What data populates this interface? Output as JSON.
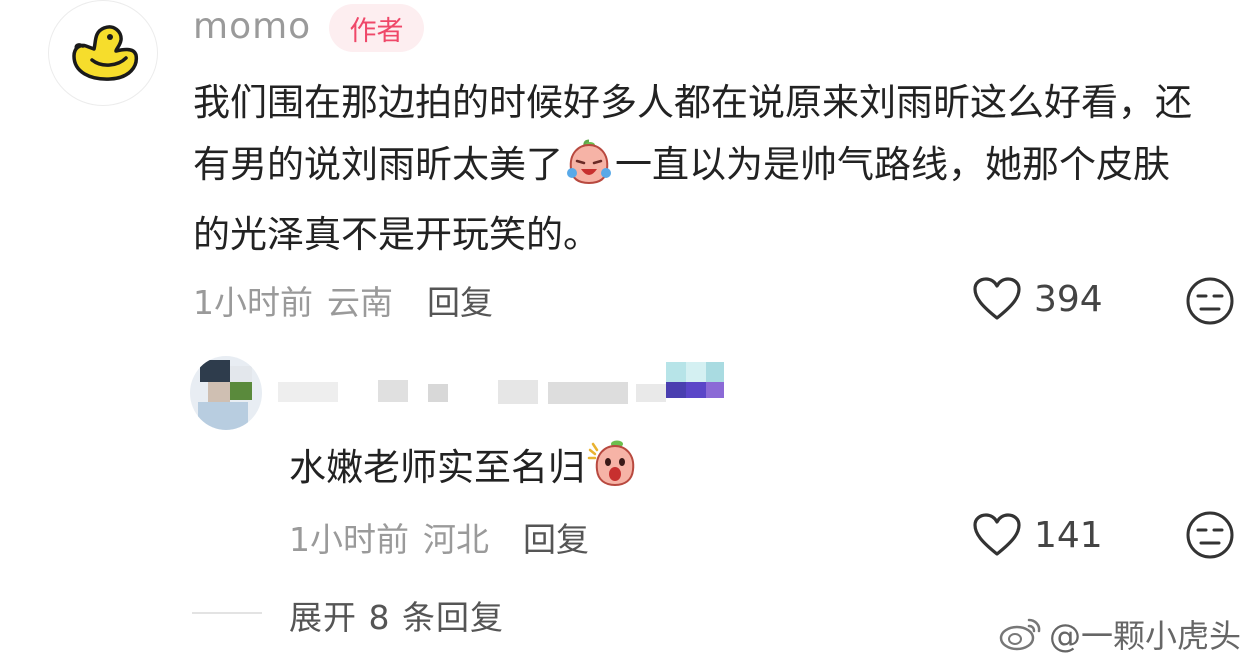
{
  "comment": {
    "author": "momo",
    "badge": "作者",
    "text_part1": "我们围在那边拍的时候好多人都在说原来刘雨昕这么好看，还有男的说刘雨昕太美了",
    "text_part2": "一直以为是帅气路线，她那个皮肤的光泽真不是开玩笑的。",
    "time": "1小时前",
    "location": "云南",
    "reply_label": "回复",
    "likes": "394",
    "avatar_icon": "duck-icon"
  },
  "reply": {
    "text": "水嫩老师实至名归",
    "time": "1小时前",
    "location": "河北",
    "reply_label": "回复",
    "likes": "141"
  },
  "expand": {
    "label": "展开 8 条回复"
  },
  "watermark": {
    "text": "@一颗小虎头"
  },
  "colors": {
    "badge_text": "#ef4869",
    "badge_bg": "#fdeef0",
    "duck_yellow": "#f6dd2c"
  }
}
